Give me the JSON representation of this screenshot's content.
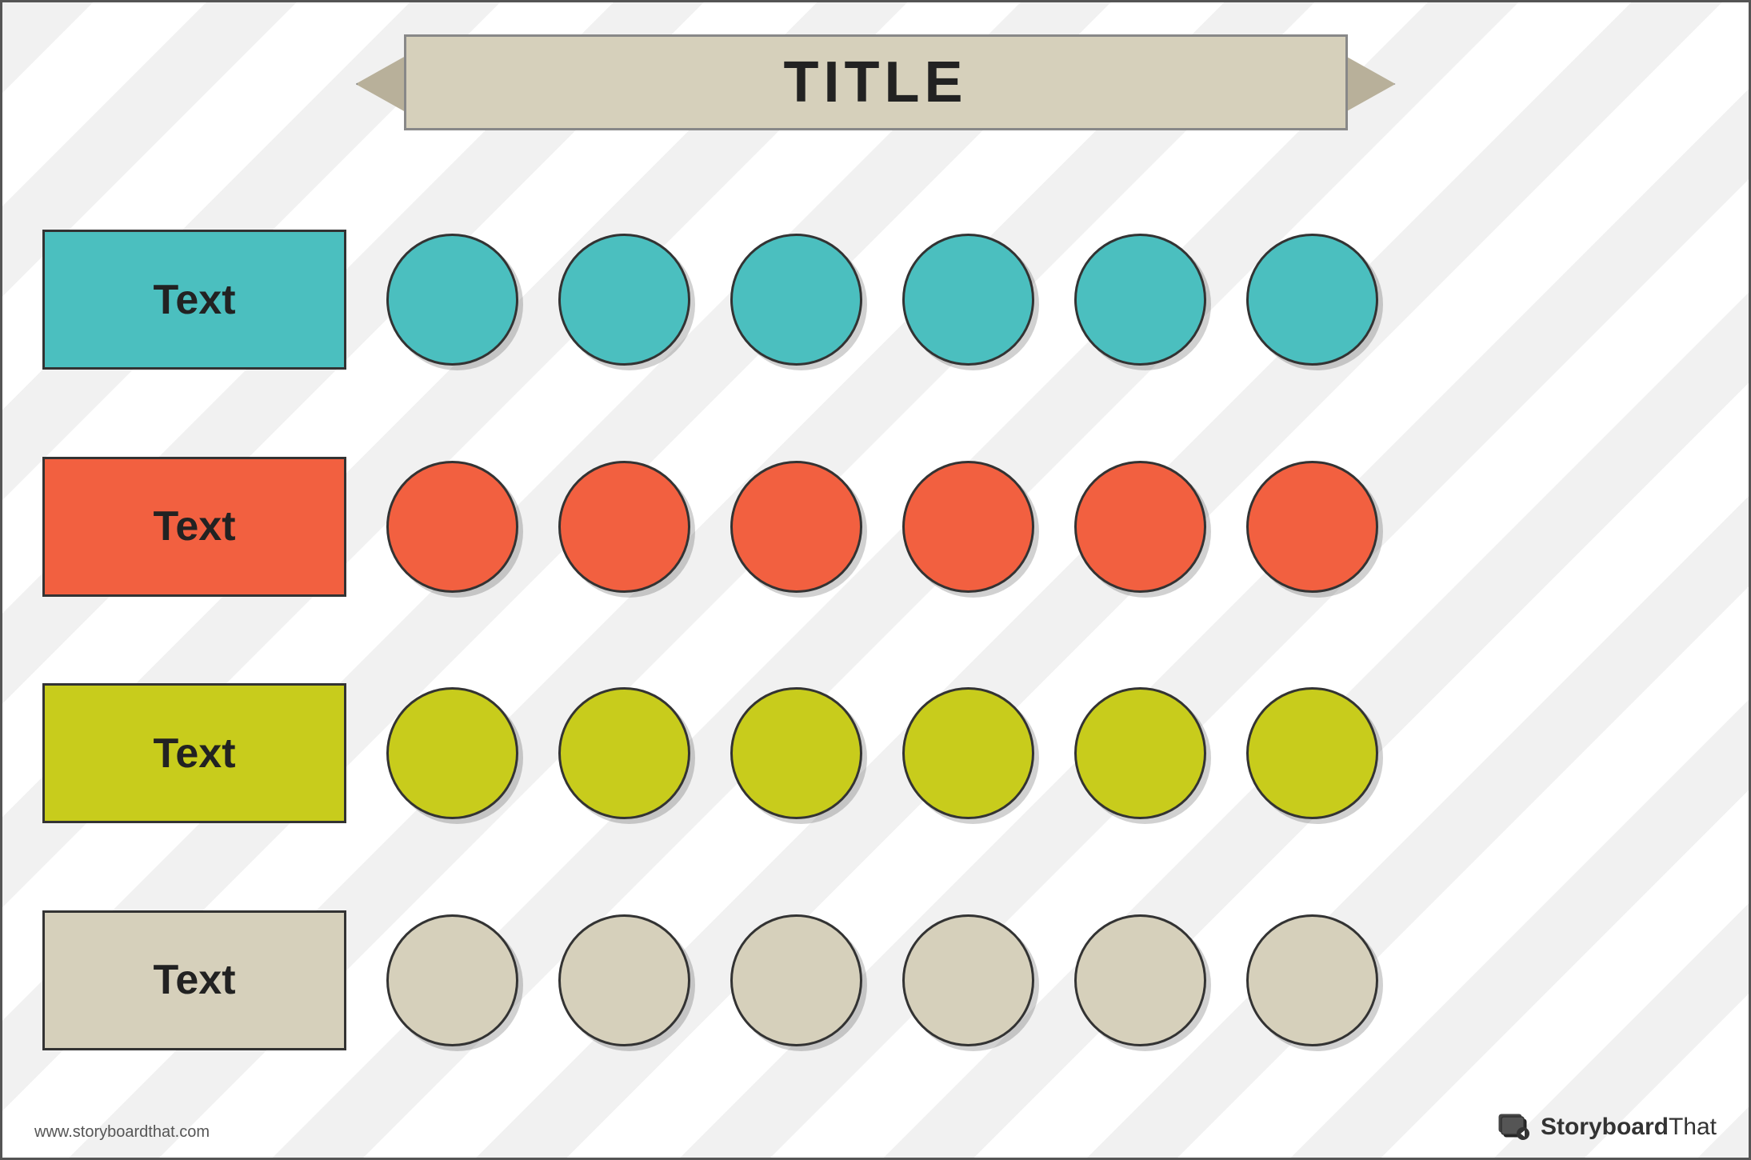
{
  "title": "TITLE",
  "rows": [
    {
      "id": "teal",
      "label": "Text",
      "colorClass": "row-teal",
      "color": "#4bbfbf",
      "circles": 6
    },
    {
      "id": "orange",
      "label": "Text",
      "colorClass": "row-orange",
      "color": "#f26040",
      "circles": 6
    },
    {
      "id": "yellow",
      "label": "Text",
      "colorClass": "row-yellow",
      "color": "#c8cc1c",
      "circles": 6
    },
    {
      "id": "beige",
      "label": "Text",
      "colorClass": "row-beige",
      "color": "#d6d0bb",
      "circles": 6
    }
  ],
  "branding": {
    "text_bold": "Storyboard",
    "text_light": "That",
    "website": "www.storyboardthat.com"
  }
}
